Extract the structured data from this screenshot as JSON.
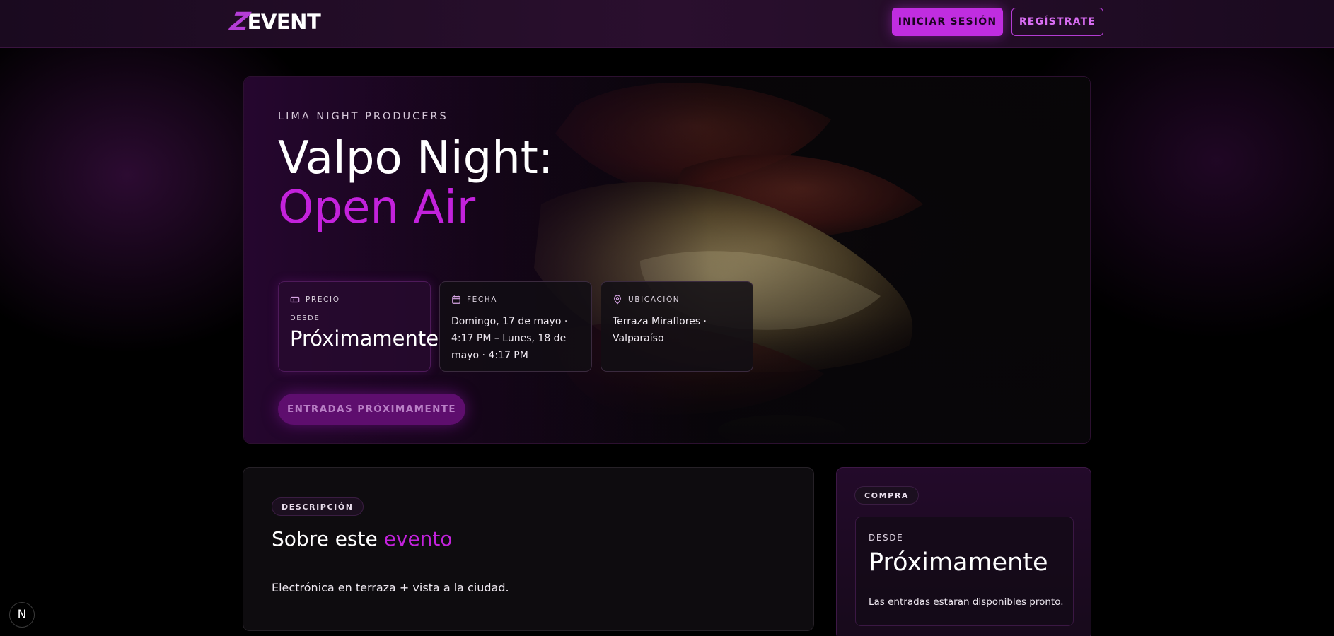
{
  "header": {
    "logo_text": "EVENT",
    "logo_mark": "Z",
    "login_label": "INICIAR SESIÓN",
    "register_label": "REGÍSTRATE"
  },
  "hero": {
    "organizer": "LIMA NIGHT PRODUCERS",
    "title_line1": "Valpo Night:",
    "title_line2": "Open Air",
    "price": {
      "label": "PRECIO",
      "icon": "ticket-icon",
      "sub": "DESDE",
      "value": "Próximamente"
    },
    "date": {
      "label": "FECHA",
      "icon": "calendar-icon",
      "value": "Domingo, 17 de mayo · 4:17 PM – Lunes, 18 de mayo · 4:17 PM"
    },
    "location": {
      "label": "UBICACIÓN",
      "icon": "map-pin-icon",
      "value": "Terraza Miraflores · Valparaíso"
    },
    "tickets_button": "ENTRADAS PRÓXIMAMENTE"
  },
  "description": {
    "pill": "DESCRIPCIÓN",
    "title_prefix": "Sobre este",
    "title_highlight": "evento",
    "body": "Electrónica en terraza + vista a la ciudad."
  },
  "purchase": {
    "pill": "COMPRA",
    "sub": "DESDE",
    "value": "Próximamente",
    "note": "Las entradas estaran disponibles pronto."
  },
  "floating_badge": "N",
  "colors": {
    "accent": "#c322dc",
    "accent_button": "#c02de0",
    "background": "#000000"
  }
}
